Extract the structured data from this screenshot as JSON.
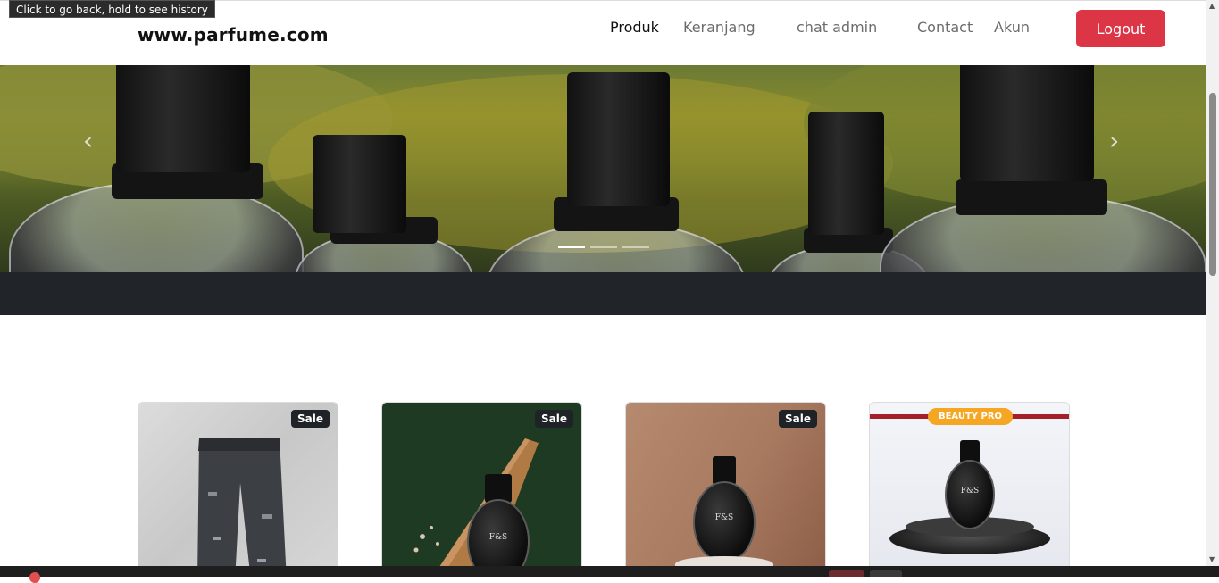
{
  "tooltip": {
    "text": "Click to go back, hold to see history"
  },
  "navbar": {
    "brand": "www.parfume.com",
    "links": [
      {
        "label": "Produk",
        "active": true
      },
      {
        "label": "Keranjang",
        "active": false
      },
      {
        "label": "chat admin",
        "active": false
      },
      {
        "label": "Contact",
        "active": false
      },
      {
        "label": "Akun",
        "active": false
      }
    ],
    "logout_label": "Logout"
  },
  "carousel": {
    "prev_icon": "chevron-left-icon",
    "next_icon": "chevron-right-icon",
    "slide_count": 3,
    "active_index": 0
  },
  "products": [
    {
      "badge": "Sale",
      "image": "black distressed jeans"
    },
    {
      "badge": "Sale",
      "image": "perfume bottle on wood with dried flowers"
    },
    {
      "badge": "Sale",
      "image": "perfume bottle on beige background"
    },
    {
      "badge": "BEAUTY PRO",
      "image": "perfume bottle on pedestal"
    }
  ],
  "bottle_label": "F&S",
  "colors": {
    "logout": "#dc3545",
    "dark_band": "#212529",
    "badge_bg": "#1f2327",
    "beauty_pro": "#f5a623"
  }
}
